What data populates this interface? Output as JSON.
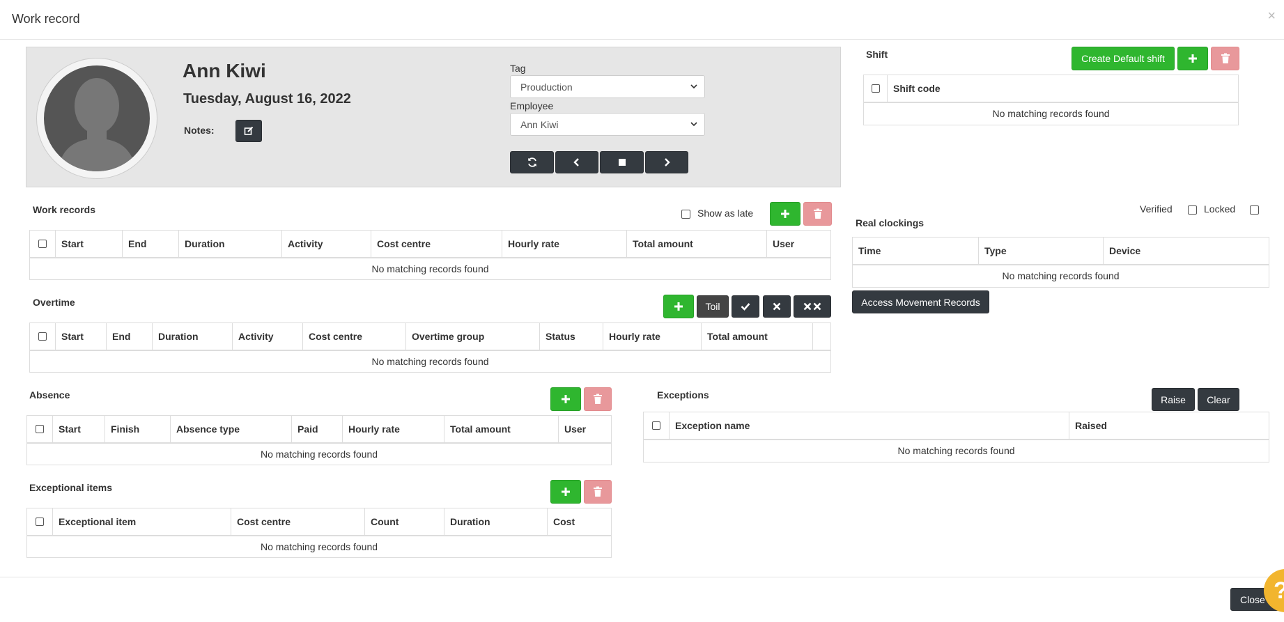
{
  "modal": {
    "title": "Work record",
    "close_label": "Close"
  },
  "profile": {
    "name": "Ann Kiwi",
    "date": "Tuesday, August 16, 2022",
    "notes_label": "Notes:",
    "tag_label": "Tag",
    "tag_value": "Prouduction",
    "employee_label": "Employee",
    "employee_value": "Ann Kiwi"
  },
  "shift": {
    "title": "Shift",
    "create_default_label": "Create Default shift",
    "columns": [
      "Shift code"
    ],
    "empty_text": "No matching records found"
  },
  "work_records": {
    "title": "Work records",
    "show_as_late_label": "Show as late",
    "columns": [
      "Start",
      "End",
      "Duration",
      "Activity",
      "Cost centre",
      "Hourly rate",
      "Total amount",
      "User"
    ],
    "empty_text": "No matching records found"
  },
  "real_clockings": {
    "title": "Real clockings",
    "verified_label": "Verified",
    "locked_label": "Locked",
    "columns": [
      "Time",
      "Type",
      "Device"
    ],
    "empty_text": "No matching records found",
    "access_button_label": "Access Movement Records"
  },
  "overtime": {
    "title": "Overtime",
    "toil_label": "Toil",
    "columns": [
      "Start",
      "End",
      "Duration",
      "Activity",
      "Cost centre",
      "Overtime group",
      "Status",
      "Hourly rate",
      "Total amount"
    ],
    "empty_text": "No matching records found"
  },
  "absence": {
    "title": "Absence",
    "columns": [
      "Start",
      "Finish",
      "Absence type",
      "Paid",
      "Hourly rate",
      "Total amount",
      "User"
    ],
    "empty_text": "No matching records found"
  },
  "exceptions": {
    "title": "Exceptions",
    "raise_label": "Raise",
    "clear_label": "Clear",
    "columns": [
      "Exception name",
      "Raised"
    ],
    "empty_text": "No matching records found"
  },
  "exceptional_items": {
    "title": "Exceptional items",
    "columns": [
      "Exceptional item",
      "Cost centre",
      "Count",
      "Duration",
      "Cost"
    ],
    "empty_text": "No matching records found"
  },
  "help": {
    "glyph": "?"
  }
}
